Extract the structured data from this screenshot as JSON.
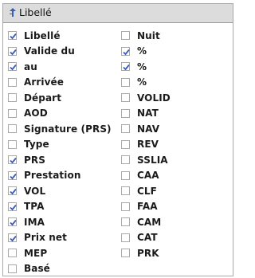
{
  "header": {
    "label": "Libellé"
  },
  "columns_left": [
    {
      "label": "Libellé",
      "checked": true
    },
    {
      "label": "Valide du",
      "checked": true
    },
    {
      "label": "au",
      "checked": true
    },
    {
      "label": "Arrivée",
      "checked": false
    },
    {
      "label": "Départ",
      "checked": false
    },
    {
      "label": "AOD",
      "checked": false
    },
    {
      "label": "Signature (PRS)",
      "checked": false
    },
    {
      "label": "Type",
      "checked": false
    },
    {
      "label": "PRS",
      "checked": true
    },
    {
      "label": "Prestation",
      "checked": true
    },
    {
      "label": "VOL",
      "checked": true
    },
    {
      "label": "TPA",
      "checked": true
    },
    {
      "label": "IMA",
      "checked": true
    },
    {
      "label": "Prix net",
      "checked": true
    },
    {
      "label": "MEP",
      "checked": false
    },
    {
      "label": "Basé",
      "checked": false
    }
  ],
  "columns_right": [
    {
      "label": "Nuit",
      "checked": false
    },
    {
      "label": "%",
      "checked": true
    },
    {
      "label": "%",
      "checked": true
    },
    {
      "label": "%",
      "checked": false
    },
    {
      "label": "VOLID",
      "checked": false
    },
    {
      "label": "NAT",
      "checked": false
    },
    {
      "label": "NAV",
      "checked": false
    },
    {
      "label": "REV",
      "checked": false
    },
    {
      "label": "SSLIA",
      "checked": false
    },
    {
      "label": "CAA",
      "checked": false
    },
    {
      "label": "CLF",
      "checked": false
    },
    {
      "label": "FAA",
      "checked": false
    },
    {
      "label": "CAM",
      "checked": false
    },
    {
      "label": "CAT",
      "checked": false
    },
    {
      "label": "PRK",
      "checked": false
    }
  ],
  "colors": {
    "check": "#3a5bbf",
    "border": "#a9a9a9",
    "header_bg": "#dcdcdc"
  }
}
